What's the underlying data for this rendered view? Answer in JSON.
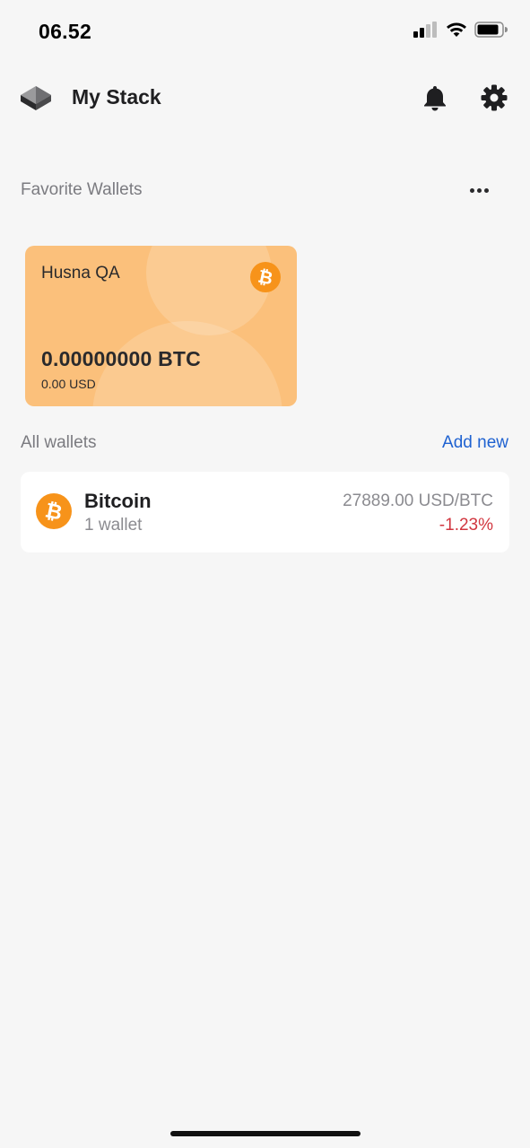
{
  "status_bar": {
    "time": "06.52",
    "icons": [
      "signal-icon",
      "wifi-icon",
      "battery-icon"
    ]
  },
  "header": {
    "title": "My Stack",
    "icons": [
      "stack-logo-icon",
      "bell-icon",
      "gear-icon"
    ]
  },
  "favorites": {
    "label": "Favorite Wallets",
    "more_icon": "more-horizontal-icon",
    "cards": [
      {
        "name": "Husna QA",
        "balance": "0.00000000 BTC",
        "fiat": "0.00 USD",
        "coin_icon": "bitcoin-icon",
        "color": "#fbc07b"
      }
    ]
  },
  "all_wallets": {
    "label": "All wallets",
    "add_label": "Add new",
    "assets": [
      {
        "name": "Bitcoin",
        "count": "1 wallet",
        "price": "27889.00 USD/BTC",
        "change": "-1.23%",
        "icon": "bitcoin-icon",
        "change_color": "#d1363f"
      }
    ]
  },
  "colors": {
    "accent_link": "#1f62d1",
    "bitcoin_orange": "#f7931a",
    "background": "#f6f6f6"
  }
}
